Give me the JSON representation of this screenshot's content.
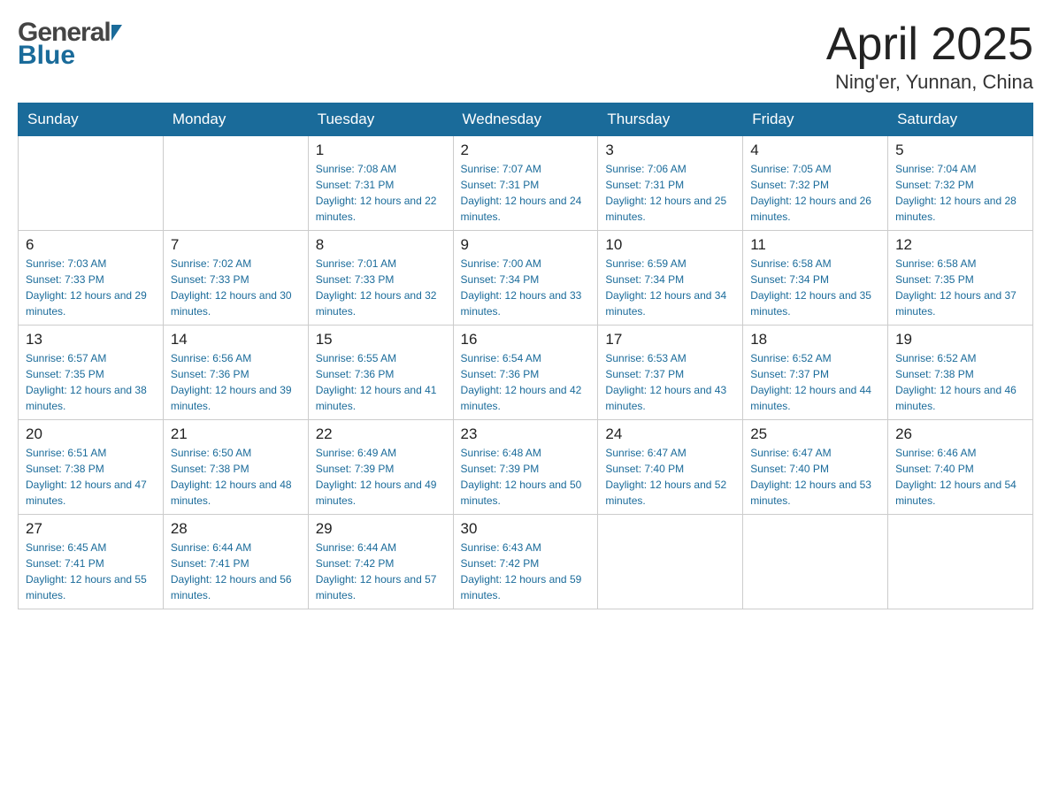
{
  "header": {
    "logo": {
      "general": "General",
      "blue": "Blue"
    },
    "title": "April 2025",
    "location": "Ning'er, Yunnan, China"
  },
  "days_of_week": [
    "Sunday",
    "Monday",
    "Tuesday",
    "Wednesday",
    "Thursday",
    "Friday",
    "Saturday"
  ],
  "weeks": [
    {
      "days": [
        {
          "number": "",
          "sunrise": "",
          "sunset": "",
          "daylight": ""
        },
        {
          "number": "",
          "sunrise": "",
          "sunset": "",
          "daylight": ""
        },
        {
          "number": "1",
          "sunrise": "Sunrise: 7:08 AM",
          "sunset": "Sunset: 7:31 PM",
          "daylight": "Daylight: 12 hours and 22 minutes."
        },
        {
          "number": "2",
          "sunrise": "Sunrise: 7:07 AM",
          "sunset": "Sunset: 7:31 PM",
          "daylight": "Daylight: 12 hours and 24 minutes."
        },
        {
          "number": "3",
          "sunrise": "Sunrise: 7:06 AM",
          "sunset": "Sunset: 7:31 PM",
          "daylight": "Daylight: 12 hours and 25 minutes."
        },
        {
          "number": "4",
          "sunrise": "Sunrise: 7:05 AM",
          "sunset": "Sunset: 7:32 PM",
          "daylight": "Daylight: 12 hours and 26 minutes."
        },
        {
          "number": "5",
          "sunrise": "Sunrise: 7:04 AM",
          "sunset": "Sunset: 7:32 PM",
          "daylight": "Daylight: 12 hours and 28 minutes."
        }
      ]
    },
    {
      "days": [
        {
          "number": "6",
          "sunrise": "Sunrise: 7:03 AM",
          "sunset": "Sunset: 7:33 PM",
          "daylight": "Daylight: 12 hours and 29 minutes."
        },
        {
          "number": "7",
          "sunrise": "Sunrise: 7:02 AM",
          "sunset": "Sunset: 7:33 PM",
          "daylight": "Daylight: 12 hours and 30 minutes."
        },
        {
          "number": "8",
          "sunrise": "Sunrise: 7:01 AM",
          "sunset": "Sunset: 7:33 PM",
          "daylight": "Daylight: 12 hours and 32 minutes."
        },
        {
          "number": "9",
          "sunrise": "Sunrise: 7:00 AM",
          "sunset": "Sunset: 7:34 PM",
          "daylight": "Daylight: 12 hours and 33 minutes."
        },
        {
          "number": "10",
          "sunrise": "Sunrise: 6:59 AM",
          "sunset": "Sunset: 7:34 PM",
          "daylight": "Daylight: 12 hours and 34 minutes."
        },
        {
          "number": "11",
          "sunrise": "Sunrise: 6:58 AM",
          "sunset": "Sunset: 7:34 PM",
          "daylight": "Daylight: 12 hours and 35 minutes."
        },
        {
          "number": "12",
          "sunrise": "Sunrise: 6:58 AM",
          "sunset": "Sunset: 7:35 PM",
          "daylight": "Daylight: 12 hours and 37 minutes."
        }
      ]
    },
    {
      "days": [
        {
          "number": "13",
          "sunrise": "Sunrise: 6:57 AM",
          "sunset": "Sunset: 7:35 PM",
          "daylight": "Daylight: 12 hours and 38 minutes."
        },
        {
          "number": "14",
          "sunrise": "Sunrise: 6:56 AM",
          "sunset": "Sunset: 7:36 PM",
          "daylight": "Daylight: 12 hours and 39 minutes."
        },
        {
          "number": "15",
          "sunrise": "Sunrise: 6:55 AM",
          "sunset": "Sunset: 7:36 PM",
          "daylight": "Daylight: 12 hours and 41 minutes."
        },
        {
          "number": "16",
          "sunrise": "Sunrise: 6:54 AM",
          "sunset": "Sunset: 7:36 PM",
          "daylight": "Daylight: 12 hours and 42 minutes."
        },
        {
          "number": "17",
          "sunrise": "Sunrise: 6:53 AM",
          "sunset": "Sunset: 7:37 PM",
          "daylight": "Daylight: 12 hours and 43 minutes."
        },
        {
          "number": "18",
          "sunrise": "Sunrise: 6:52 AM",
          "sunset": "Sunset: 7:37 PM",
          "daylight": "Daylight: 12 hours and 44 minutes."
        },
        {
          "number": "19",
          "sunrise": "Sunrise: 6:52 AM",
          "sunset": "Sunset: 7:38 PM",
          "daylight": "Daylight: 12 hours and 46 minutes."
        }
      ]
    },
    {
      "days": [
        {
          "number": "20",
          "sunrise": "Sunrise: 6:51 AM",
          "sunset": "Sunset: 7:38 PM",
          "daylight": "Daylight: 12 hours and 47 minutes."
        },
        {
          "number": "21",
          "sunrise": "Sunrise: 6:50 AM",
          "sunset": "Sunset: 7:38 PM",
          "daylight": "Daylight: 12 hours and 48 minutes."
        },
        {
          "number": "22",
          "sunrise": "Sunrise: 6:49 AM",
          "sunset": "Sunset: 7:39 PM",
          "daylight": "Daylight: 12 hours and 49 minutes."
        },
        {
          "number": "23",
          "sunrise": "Sunrise: 6:48 AM",
          "sunset": "Sunset: 7:39 PM",
          "daylight": "Daylight: 12 hours and 50 minutes."
        },
        {
          "number": "24",
          "sunrise": "Sunrise: 6:47 AM",
          "sunset": "Sunset: 7:40 PM",
          "daylight": "Daylight: 12 hours and 52 minutes."
        },
        {
          "number": "25",
          "sunrise": "Sunrise: 6:47 AM",
          "sunset": "Sunset: 7:40 PM",
          "daylight": "Daylight: 12 hours and 53 minutes."
        },
        {
          "number": "26",
          "sunrise": "Sunrise: 6:46 AM",
          "sunset": "Sunset: 7:40 PM",
          "daylight": "Daylight: 12 hours and 54 minutes."
        }
      ]
    },
    {
      "days": [
        {
          "number": "27",
          "sunrise": "Sunrise: 6:45 AM",
          "sunset": "Sunset: 7:41 PM",
          "daylight": "Daylight: 12 hours and 55 minutes."
        },
        {
          "number": "28",
          "sunrise": "Sunrise: 6:44 AM",
          "sunset": "Sunset: 7:41 PM",
          "daylight": "Daylight: 12 hours and 56 minutes."
        },
        {
          "number": "29",
          "sunrise": "Sunrise: 6:44 AM",
          "sunset": "Sunset: 7:42 PM",
          "daylight": "Daylight: 12 hours and 57 minutes."
        },
        {
          "number": "30",
          "sunrise": "Sunrise: 6:43 AM",
          "sunset": "Sunset: 7:42 PM",
          "daylight": "Daylight: 12 hours and 59 minutes."
        },
        {
          "number": "",
          "sunrise": "",
          "sunset": "",
          "daylight": ""
        },
        {
          "number": "",
          "sunrise": "",
          "sunset": "",
          "daylight": ""
        },
        {
          "number": "",
          "sunrise": "",
          "sunset": "",
          "daylight": ""
        }
      ]
    }
  ]
}
